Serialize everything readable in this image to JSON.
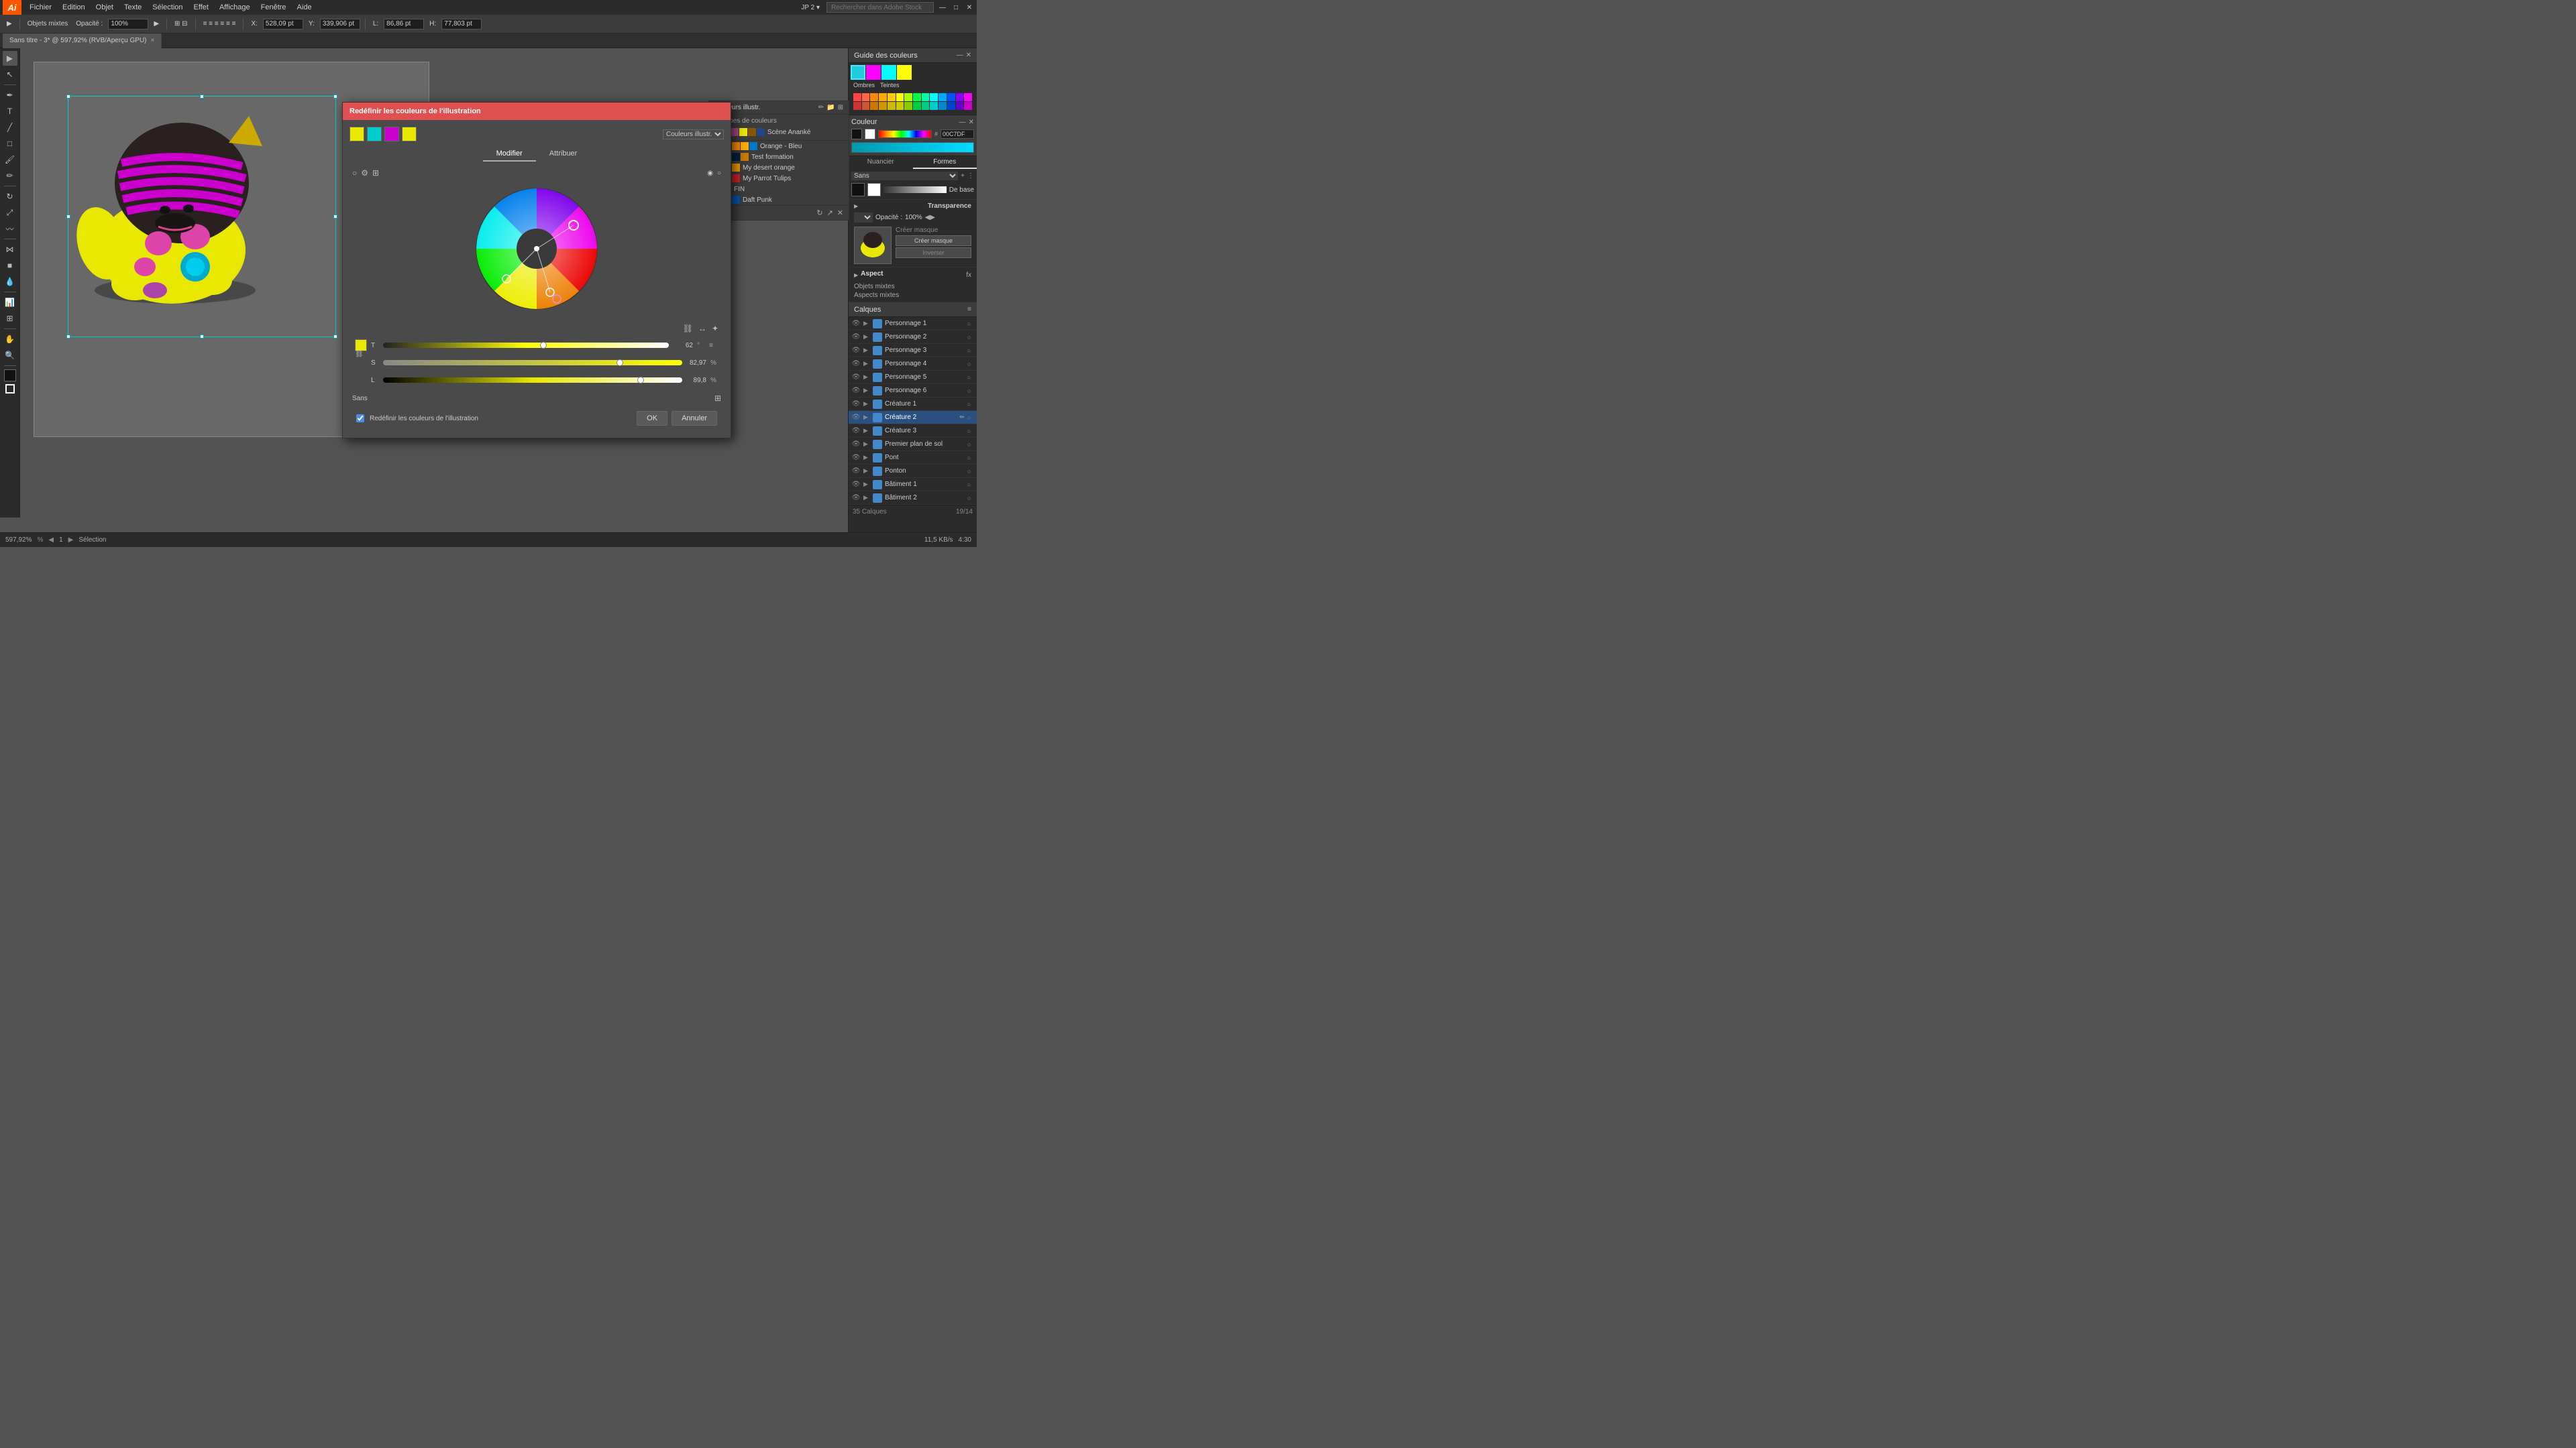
{
  "app": {
    "logo": "Ai",
    "title": "Sans titre - 3* @ 597,92% (RVB/Aperçu GPU)"
  },
  "menu": {
    "items": [
      "Fichier",
      "Edition",
      "Objet",
      "Texte",
      "Sélection",
      "Effet",
      "Affichage",
      "Fenêtre",
      "Aide"
    ]
  },
  "toolbar_top": {
    "label": "Objets mixtes",
    "opacity_label": "Opacité :",
    "opacity_value": "100%",
    "x_label": "X:",
    "x_value": "528,09 pt",
    "y_label": "Y:",
    "y_value": "339,906 pt",
    "l_label": "L:",
    "l_value": "86,86 pt",
    "h_label": "H:",
    "h_value": "77,803 pt"
  },
  "tab": {
    "label": "Sans titre - 3* @ 597,92% (RVB/Aperçu GPU)",
    "close": "×"
  },
  "dialog": {
    "title": "Redéfinir les couleurs de l'illustration",
    "tab_modifier": "Modifier",
    "tab_attribuer": "Attribuer",
    "swatches": [
      "#e8e800",
      "#00cccc",
      "#cc00cc",
      "#e8e800"
    ],
    "slider_t_label": "T",
    "slider_t_value": "62",
    "slider_s_label": "S",
    "slider_s_value": "82,97",
    "slider_s_unit": "%",
    "slider_l_label": "L",
    "slider_l_value": "89,8",
    "slider_l_unit": "%",
    "sans_label": "Sans",
    "checkbox_label": "Redéfinir les couleurs de l'illustration",
    "ok_label": "OK",
    "cancel_label": "Annuler"
  },
  "couleurs_illust": {
    "header": "Couleurs illustr.",
    "groups_label": "Groupes de couleurs",
    "scene_label": "Scène Ananké",
    "color_groups": [
      {
        "name": "Orange - Bleu",
        "colors": [
          "#e05500",
          "#e07700",
          "#e09900",
          "#0077cc"
        ]
      },
      {
        "name": "Test formation",
        "colors": [
          "#22aaaa",
          "#007755",
          "#002244",
          "#cc7700"
        ]
      },
      {
        "name": "My desert orange",
        "colors": [
          "#cc8800",
          "#dd9900",
          "#cc6600"
        ]
      },
      {
        "name": "My Parrot Tulips",
        "colors": [
          "#dddd00",
          "#22cc22",
          "#cc2222"
        ]
      },
      {
        "name": "FIN",
        "colors": [
          "#888888",
          "#cccccc"
        ]
      },
      {
        "name": "Daft Punk",
        "colors": [
          "#dd00dd",
          "#aaaa00",
          "#0055aa"
        ]
      }
    ]
  },
  "couleur_panel": {
    "title": "Couleur",
    "hex_value": "00C7DF"
  },
  "guide_panel": {
    "title": "Guide des couleurs",
    "tab_nuancier": "Nuancier",
    "tab_formes": "Formes",
    "base_label": "De base"
  },
  "transparence_panel": {
    "title": "Transparence",
    "opacity_label": "Opacité :",
    "opacity_value": "100%",
    "btn_creer": "Créer masque",
    "btn_inverser": "Inverser"
  },
  "aspect_panel": {
    "title": "Aspect",
    "item1": "Objets mixtes",
    "item2": "Aspects mixtes"
  },
  "calques_panel": {
    "title": "Calques",
    "count": "35 Calques",
    "items": [
      {
        "name": "Personnage 1",
        "visible": true,
        "locked": false,
        "color": "#4488cc"
      },
      {
        "name": "Personnage 2",
        "visible": true,
        "locked": false,
        "color": "#4488cc"
      },
      {
        "name": "Personnage 3",
        "visible": true,
        "locked": false,
        "color": "#4488cc"
      },
      {
        "name": "Personnage 4",
        "visible": true,
        "locked": false,
        "color": "#4488cc"
      },
      {
        "name": "Personnage 5",
        "visible": true,
        "locked": false,
        "color": "#4488cc"
      },
      {
        "name": "Personnage 6",
        "visible": true,
        "locked": false,
        "color": "#4488cc"
      },
      {
        "name": "Créature 1",
        "visible": true,
        "locked": false,
        "color": "#4488cc"
      },
      {
        "name": "Créature 2",
        "visible": true,
        "locked": false,
        "active": true,
        "color": "#4488cc"
      },
      {
        "name": "Créature 3",
        "visible": true,
        "locked": false,
        "color": "#4488cc"
      },
      {
        "name": "Premier plan de sol",
        "visible": true,
        "locked": false,
        "color": "#4488cc"
      },
      {
        "name": "Pont",
        "visible": true,
        "locked": false,
        "color": "#4488cc"
      },
      {
        "name": "Ponton",
        "visible": true,
        "locked": false,
        "color": "#4488cc"
      },
      {
        "name": "Bâtiment 1",
        "visible": true,
        "locked": false,
        "color": "#4488cc"
      },
      {
        "name": "Bâtiment 2",
        "visible": true,
        "locked": false,
        "color": "#4488cc"
      }
    ]
  },
  "status_bar": {
    "zoom": "597,92%",
    "page": "1",
    "tool": "Sélection",
    "kb": "11,5 KB/s",
    "time": "4:30",
    "date": "19/14"
  }
}
